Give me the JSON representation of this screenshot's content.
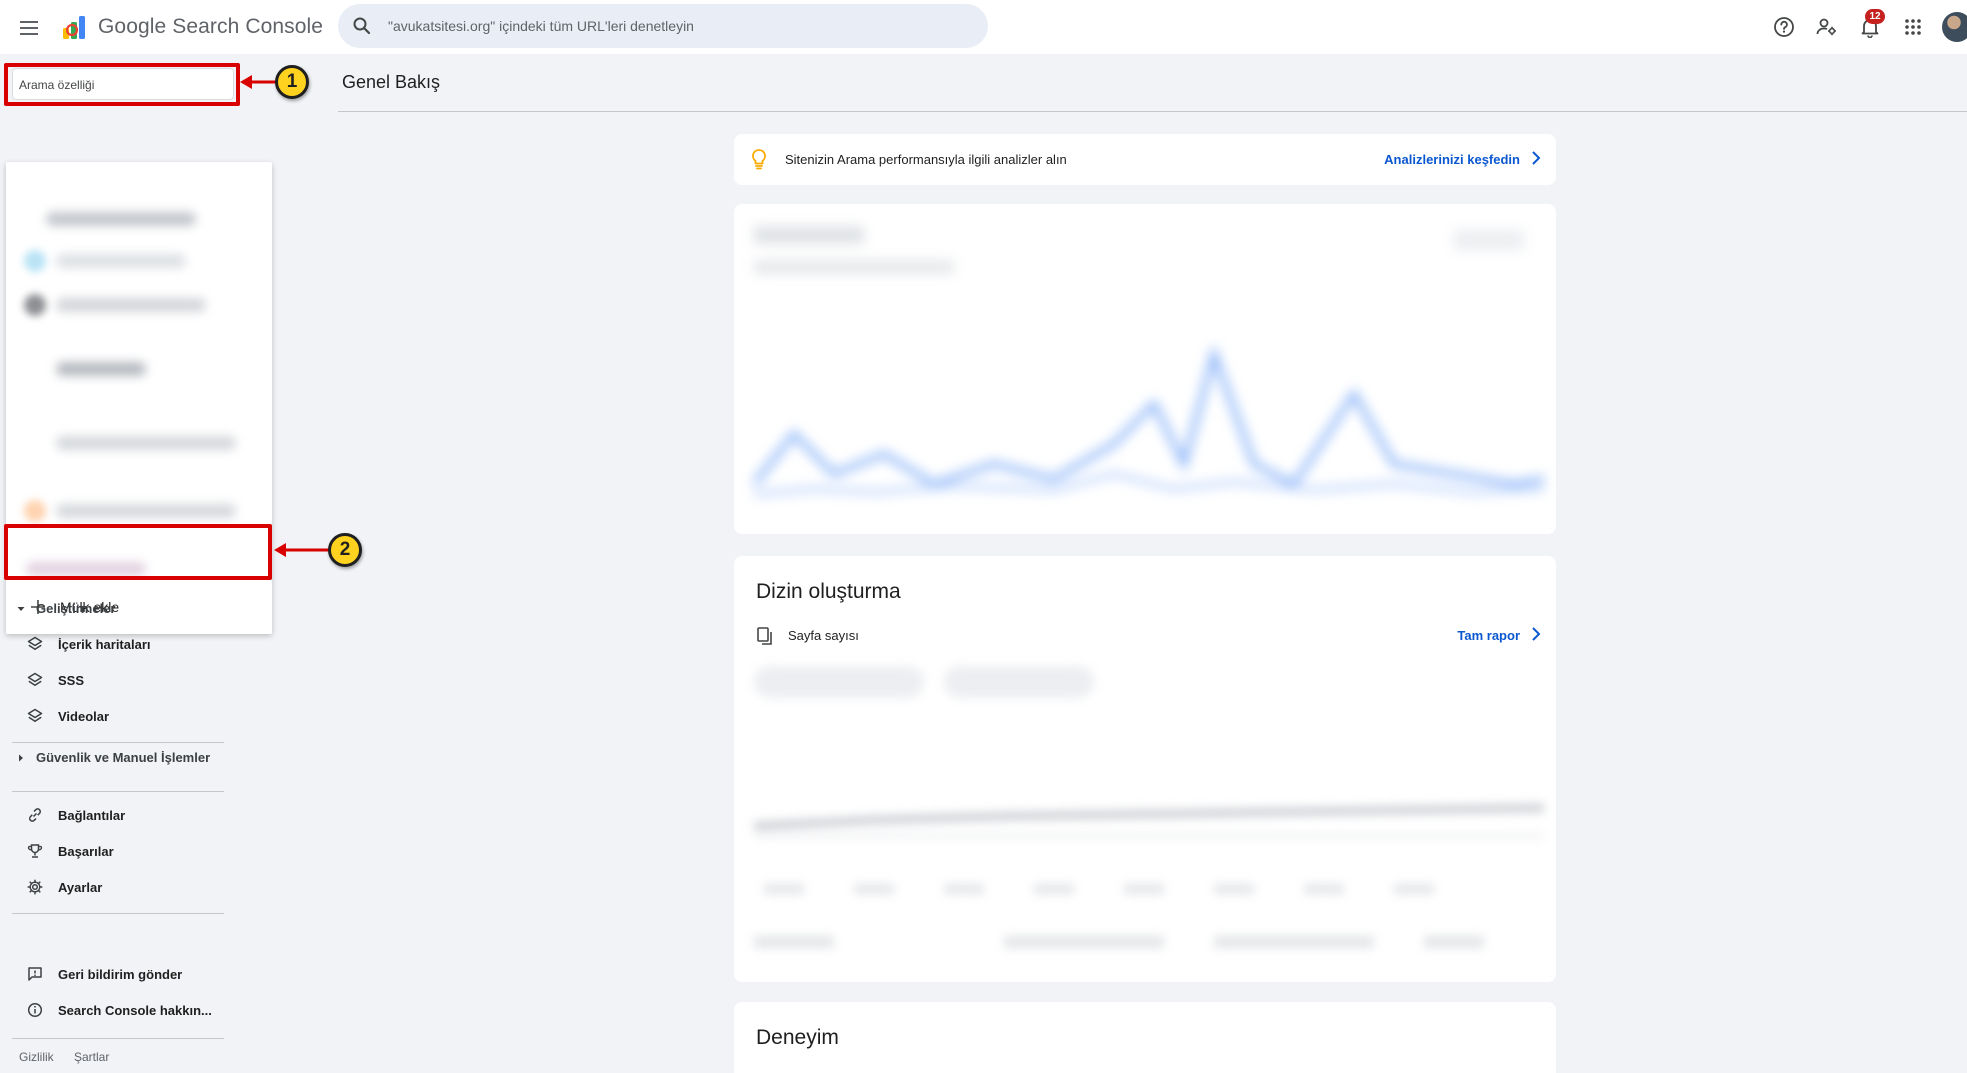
{
  "header": {
    "app_name": "Google Search Console",
    "search_placeholder": "\"avukatsitesi.org\" içindeki tüm URL'leri denetleyin",
    "notification_count": "12",
    "icons": [
      "menu-icon",
      "help-icon",
      "manage-users-icon",
      "notifications-icon",
      "apps-grid-icon",
      "account-avatar"
    ]
  },
  "sidebar": {
    "property_search_placeholder": "Arama özelliği",
    "add_property_label": "Mülk ekle",
    "sections": {
      "enhancements": {
        "label": "Geliştirmeler",
        "items": [
          "İçerik haritaları",
          "SSS",
          "Videolar"
        ]
      },
      "security": {
        "label": "Güvenlik ve Manuel İşlemler"
      }
    },
    "links_label": "Bağlantılar",
    "achievements_label": "Başarılar",
    "settings_label": "Ayarlar",
    "feedback_label": "Geri bildirim gönder",
    "about_label": "Search Console hakkın...",
    "privacy_label": "Gizlilik",
    "terms_label": "Şartlar"
  },
  "main": {
    "page_title": "Genel Bakış",
    "tip_text": "Sitenizin Arama performansıyla ilgili analizler alın",
    "tip_link": "Analizlerinizi keşfedin",
    "indexing": {
      "title": "Dizin oluşturma",
      "pages_label": "Sayfa sayısı",
      "full_report_link": "Tam rapor"
    },
    "experience_title": "Deneyim"
  },
  "annotations": {
    "step1": "1",
    "step2": "2",
    "color": "#d90000",
    "badge_color": "#ffd21f"
  },
  "colors": {
    "link_blue": "#0b57d0",
    "notification_red": "#c5221f",
    "background": "#f1f3f6"
  }
}
